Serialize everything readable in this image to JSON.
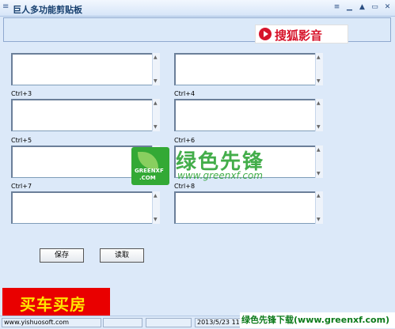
{
  "window": {
    "title": "巨人多功能剪贴板",
    "controls": {
      "menu": "≡",
      "minimize": "▁",
      "up": "▲",
      "restore": "▭",
      "close": "✕"
    }
  },
  "ads": {
    "top_logo_text": "搜狐影音",
    "bottom_left_text": "买车买房"
  },
  "clips": [
    {
      "label": "",
      "value": ""
    },
    {
      "label": "",
      "value": ""
    },
    {
      "label": "Ctrl+3",
      "value": ""
    },
    {
      "label": "Ctrl+4",
      "value": ""
    },
    {
      "label": "Ctrl+5",
      "value": ""
    },
    {
      "label": "Ctrl+6",
      "value": ""
    },
    {
      "label": "Ctrl+7",
      "value": ""
    },
    {
      "label": "Ctrl+8",
      "value": ""
    }
  ],
  "buttons": {
    "save": "保存",
    "read": "读取"
  },
  "status": {
    "website": "www.yishuosoft.com",
    "panel2": "",
    "panel3": "",
    "datetime": "2013/5/23 11:"
  },
  "watermark": {
    "logo_line1": "GREENXF",
    "logo_line2": ".COM",
    "brand": "绿色先锋",
    "url": "www.greenxf.com",
    "bottom": "绿色先锋下载(www.greenxf.com)"
  },
  "colors": {
    "window_bg": "#dce9f9",
    "title_text": "#17406f",
    "ad_red": "#e90000",
    "watermark_green": "#2fa537"
  }
}
